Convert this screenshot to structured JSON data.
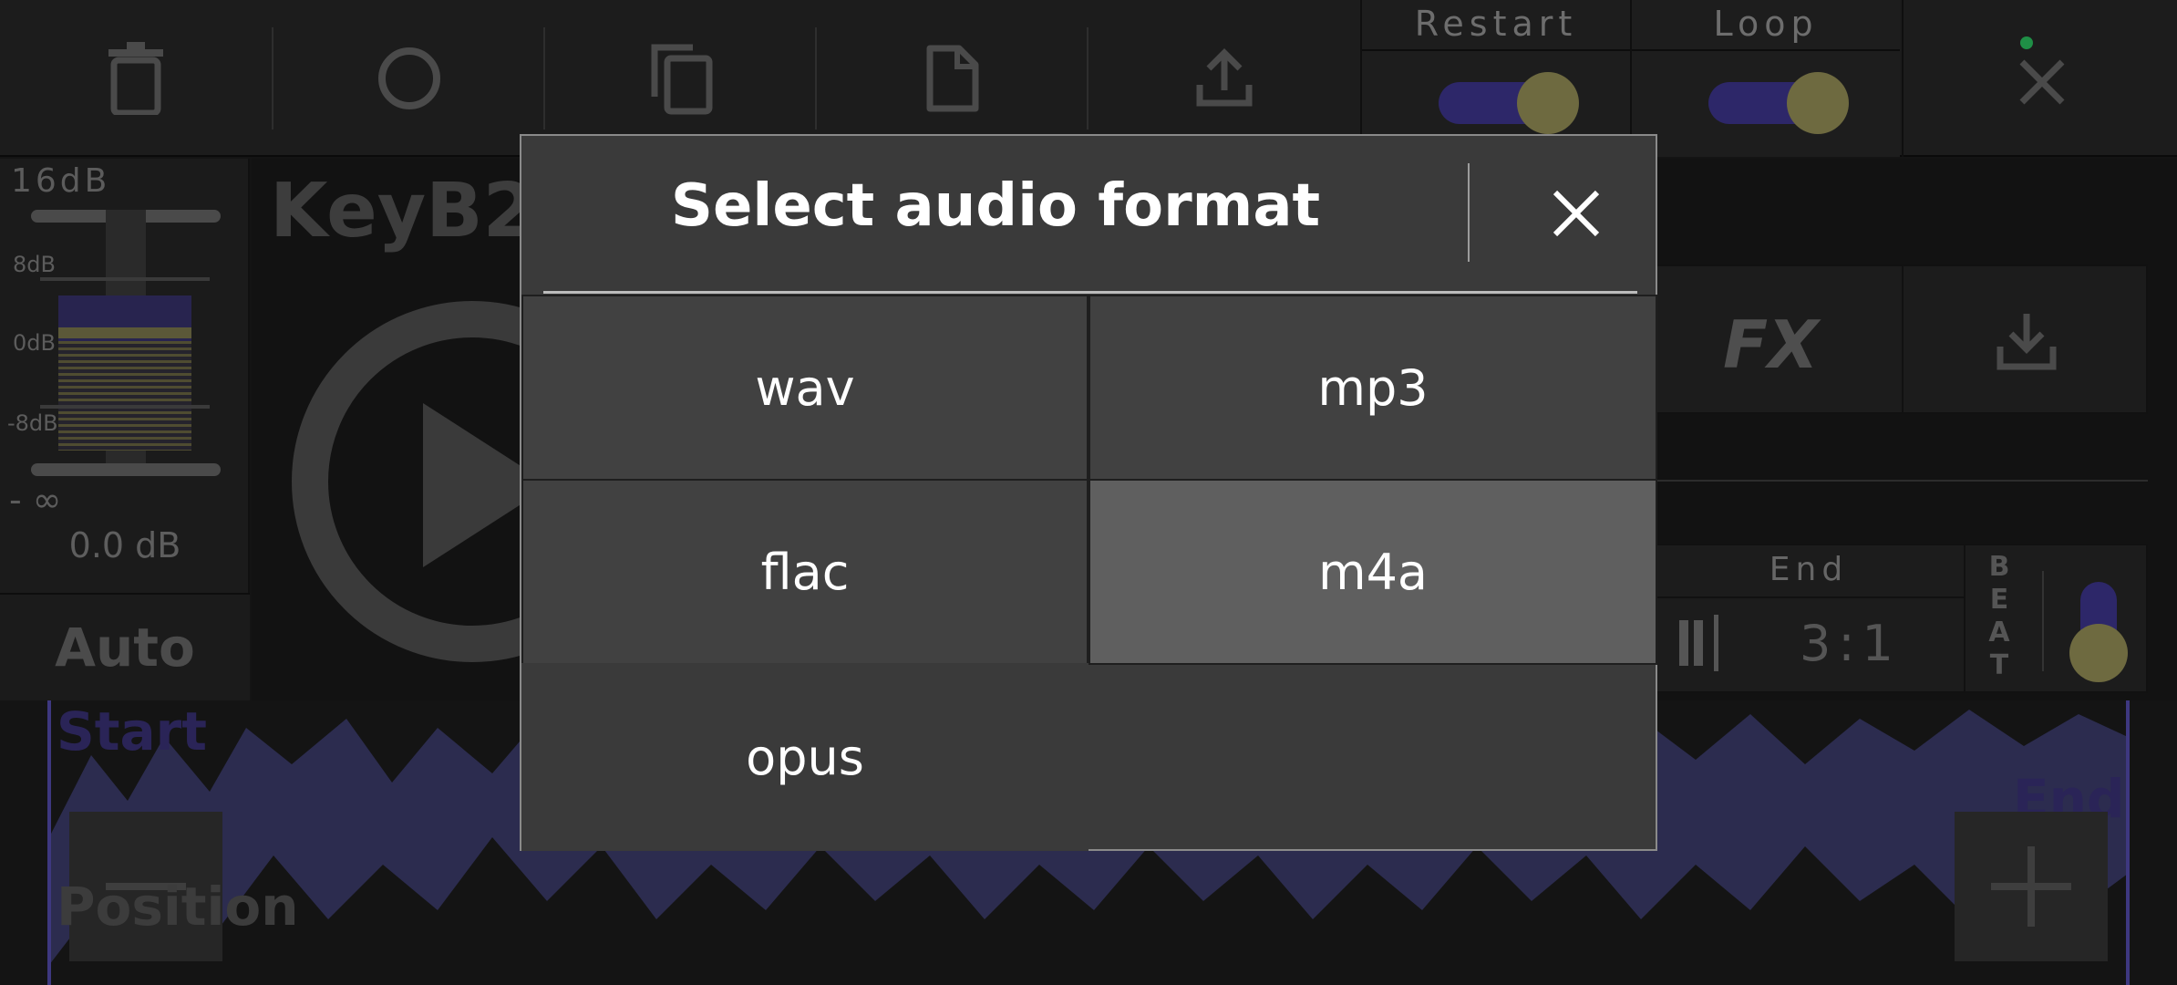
{
  "toolbar": {
    "icons": [
      "trash-icon",
      "record-icon",
      "copy-icon",
      "file-icon",
      "share-icon"
    ],
    "restart_label": "Restart",
    "loop_label": "Loop",
    "close_icon": "close-icon"
  },
  "meter": {
    "top_label": "16dB",
    "mark_8": "8dB",
    "mark_0": "0dB",
    "mark_neg8": "-8dB",
    "neg_inf": "- ∞",
    "value": "0.0 dB",
    "auto_label": "Auto"
  },
  "track": {
    "title": "KeyB2"
  },
  "right_panel": {
    "fx_label": "FX",
    "end_label": "End",
    "end_value": "3:1",
    "beat_letters": [
      "B",
      "E",
      "A",
      "T"
    ]
  },
  "waveform": {
    "start_label": "Start",
    "position_label": "Position",
    "end_label": "End"
  },
  "dialog": {
    "title": "Select audio format",
    "options": [
      "wav",
      "mp3",
      "flac",
      "m4a",
      "opus"
    ],
    "selected": "m4a"
  },
  "colors": {
    "accent_purple": "#2d2769",
    "knob_olive": "#6e6a40",
    "status_dot": "#22cc55"
  }
}
